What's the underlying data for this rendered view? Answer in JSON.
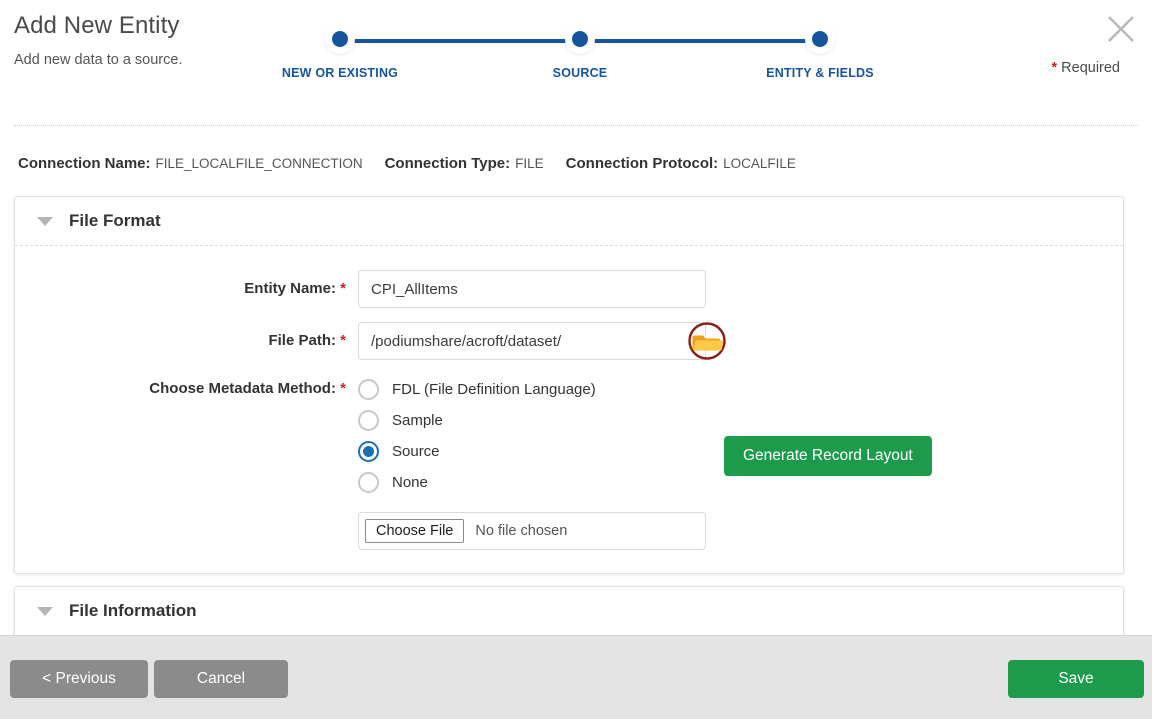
{
  "header": {
    "title": "Add New Entity",
    "subtitle": "Add new data to a source.",
    "required_note_star": "*",
    "required_note_text": "Required",
    "close_icon": "close-icon"
  },
  "stepper": {
    "steps": [
      {
        "label": "NEW OR EXISTING",
        "state": "complete"
      },
      {
        "label": "SOURCE",
        "state": "complete"
      },
      {
        "label": "ENTITY & FIELDS",
        "state": "current"
      }
    ],
    "accent_color": "#15559e"
  },
  "connection": {
    "name_label": "Connection Name:",
    "name_value": "FILE_LOCALFILE_CONNECTION",
    "type_label": "Connection Type:",
    "type_value": "FILE",
    "protocol_label": "Connection Protocol:",
    "protocol_value": "LOCALFILE"
  },
  "file_format": {
    "section_title": "File Format",
    "caret_icon": "chevron-down-icon",
    "entity_name": {
      "label": "Entity Name:",
      "required": "*",
      "value": "CPI_AllItems",
      "placeholder": ""
    },
    "file_path": {
      "label": "File Path:",
      "required": "*",
      "value": "/podiumshare/acroft/dataset/",
      "placeholder": "",
      "browse_icon": "folder-icon"
    },
    "metadata_method": {
      "label": "Choose Metadata Method:",
      "required": "*",
      "options": [
        {
          "label": "FDL (File Definition Language)",
          "selected": false
        },
        {
          "label": "Sample",
          "selected": false
        },
        {
          "label": "Source",
          "selected": true
        },
        {
          "label": "None",
          "selected": false
        }
      ],
      "generate_button": "Generate Record Layout",
      "generate_button_color": "#1d9b4d"
    },
    "file_upload": {
      "button_label": "Choose File",
      "status_text": "No file chosen"
    }
  },
  "file_information": {
    "section_title": "File Information",
    "caret_icon": "chevron-down-icon"
  },
  "footer": {
    "previous_label": "< Previous",
    "cancel_label": "Cancel",
    "save_label": "Save",
    "neutral_color": "#8b8b8b",
    "save_color": "#1d9b4d"
  }
}
